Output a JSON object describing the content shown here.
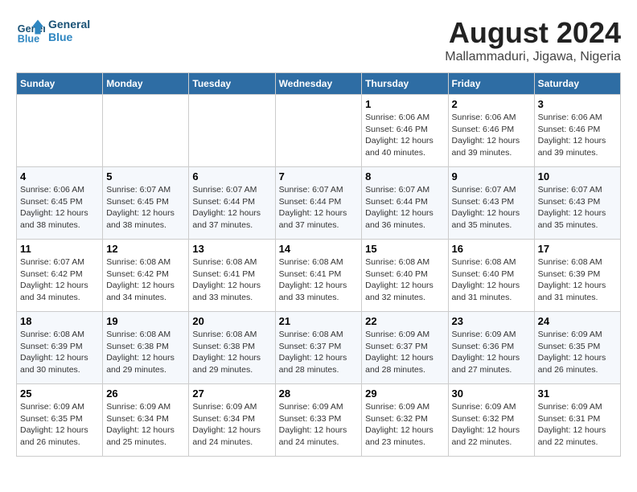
{
  "header": {
    "logo_line1": "General",
    "logo_line2": "Blue",
    "title": "August 2024",
    "subtitle": "Mallammaduri, Jigawa, Nigeria"
  },
  "days_of_week": [
    "Sunday",
    "Monday",
    "Tuesday",
    "Wednesday",
    "Thursday",
    "Friday",
    "Saturday"
  ],
  "weeks": [
    [
      {
        "day": "",
        "info": ""
      },
      {
        "day": "",
        "info": ""
      },
      {
        "day": "",
        "info": ""
      },
      {
        "day": "",
        "info": ""
      },
      {
        "day": "1",
        "info": "Sunrise: 6:06 AM\nSunset: 6:46 PM\nDaylight: 12 hours\nand 40 minutes."
      },
      {
        "day": "2",
        "info": "Sunrise: 6:06 AM\nSunset: 6:46 PM\nDaylight: 12 hours\nand 39 minutes."
      },
      {
        "day": "3",
        "info": "Sunrise: 6:06 AM\nSunset: 6:46 PM\nDaylight: 12 hours\nand 39 minutes."
      }
    ],
    [
      {
        "day": "4",
        "info": "Sunrise: 6:06 AM\nSunset: 6:45 PM\nDaylight: 12 hours\nand 38 minutes."
      },
      {
        "day": "5",
        "info": "Sunrise: 6:07 AM\nSunset: 6:45 PM\nDaylight: 12 hours\nand 38 minutes."
      },
      {
        "day": "6",
        "info": "Sunrise: 6:07 AM\nSunset: 6:44 PM\nDaylight: 12 hours\nand 37 minutes."
      },
      {
        "day": "7",
        "info": "Sunrise: 6:07 AM\nSunset: 6:44 PM\nDaylight: 12 hours\nand 37 minutes."
      },
      {
        "day": "8",
        "info": "Sunrise: 6:07 AM\nSunset: 6:44 PM\nDaylight: 12 hours\nand 36 minutes."
      },
      {
        "day": "9",
        "info": "Sunrise: 6:07 AM\nSunset: 6:43 PM\nDaylight: 12 hours\nand 35 minutes."
      },
      {
        "day": "10",
        "info": "Sunrise: 6:07 AM\nSunset: 6:43 PM\nDaylight: 12 hours\nand 35 minutes."
      }
    ],
    [
      {
        "day": "11",
        "info": "Sunrise: 6:07 AM\nSunset: 6:42 PM\nDaylight: 12 hours\nand 34 minutes."
      },
      {
        "day": "12",
        "info": "Sunrise: 6:08 AM\nSunset: 6:42 PM\nDaylight: 12 hours\nand 34 minutes."
      },
      {
        "day": "13",
        "info": "Sunrise: 6:08 AM\nSunset: 6:41 PM\nDaylight: 12 hours\nand 33 minutes."
      },
      {
        "day": "14",
        "info": "Sunrise: 6:08 AM\nSunset: 6:41 PM\nDaylight: 12 hours\nand 33 minutes."
      },
      {
        "day": "15",
        "info": "Sunrise: 6:08 AM\nSunset: 6:40 PM\nDaylight: 12 hours\nand 32 minutes."
      },
      {
        "day": "16",
        "info": "Sunrise: 6:08 AM\nSunset: 6:40 PM\nDaylight: 12 hours\nand 31 minutes."
      },
      {
        "day": "17",
        "info": "Sunrise: 6:08 AM\nSunset: 6:39 PM\nDaylight: 12 hours\nand 31 minutes."
      }
    ],
    [
      {
        "day": "18",
        "info": "Sunrise: 6:08 AM\nSunset: 6:39 PM\nDaylight: 12 hours\nand 30 minutes."
      },
      {
        "day": "19",
        "info": "Sunrise: 6:08 AM\nSunset: 6:38 PM\nDaylight: 12 hours\nand 29 minutes."
      },
      {
        "day": "20",
        "info": "Sunrise: 6:08 AM\nSunset: 6:38 PM\nDaylight: 12 hours\nand 29 minutes."
      },
      {
        "day": "21",
        "info": "Sunrise: 6:08 AM\nSunset: 6:37 PM\nDaylight: 12 hours\nand 28 minutes."
      },
      {
        "day": "22",
        "info": "Sunrise: 6:09 AM\nSunset: 6:37 PM\nDaylight: 12 hours\nand 28 minutes."
      },
      {
        "day": "23",
        "info": "Sunrise: 6:09 AM\nSunset: 6:36 PM\nDaylight: 12 hours\nand 27 minutes."
      },
      {
        "day": "24",
        "info": "Sunrise: 6:09 AM\nSunset: 6:35 PM\nDaylight: 12 hours\nand 26 minutes."
      }
    ],
    [
      {
        "day": "25",
        "info": "Sunrise: 6:09 AM\nSunset: 6:35 PM\nDaylight: 12 hours\nand 26 minutes."
      },
      {
        "day": "26",
        "info": "Sunrise: 6:09 AM\nSunset: 6:34 PM\nDaylight: 12 hours\nand 25 minutes."
      },
      {
        "day": "27",
        "info": "Sunrise: 6:09 AM\nSunset: 6:34 PM\nDaylight: 12 hours\nand 24 minutes."
      },
      {
        "day": "28",
        "info": "Sunrise: 6:09 AM\nSunset: 6:33 PM\nDaylight: 12 hours\nand 24 minutes."
      },
      {
        "day": "29",
        "info": "Sunrise: 6:09 AM\nSunset: 6:32 PM\nDaylight: 12 hours\nand 23 minutes."
      },
      {
        "day": "30",
        "info": "Sunrise: 6:09 AM\nSunset: 6:32 PM\nDaylight: 12 hours\nand 22 minutes."
      },
      {
        "day": "31",
        "info": "Sunrise: 6:09 AM\nSunset: 6:31 PM\nDaylight: 12 hours\nand 22 minutes."
      }
    ]
  ]
}
